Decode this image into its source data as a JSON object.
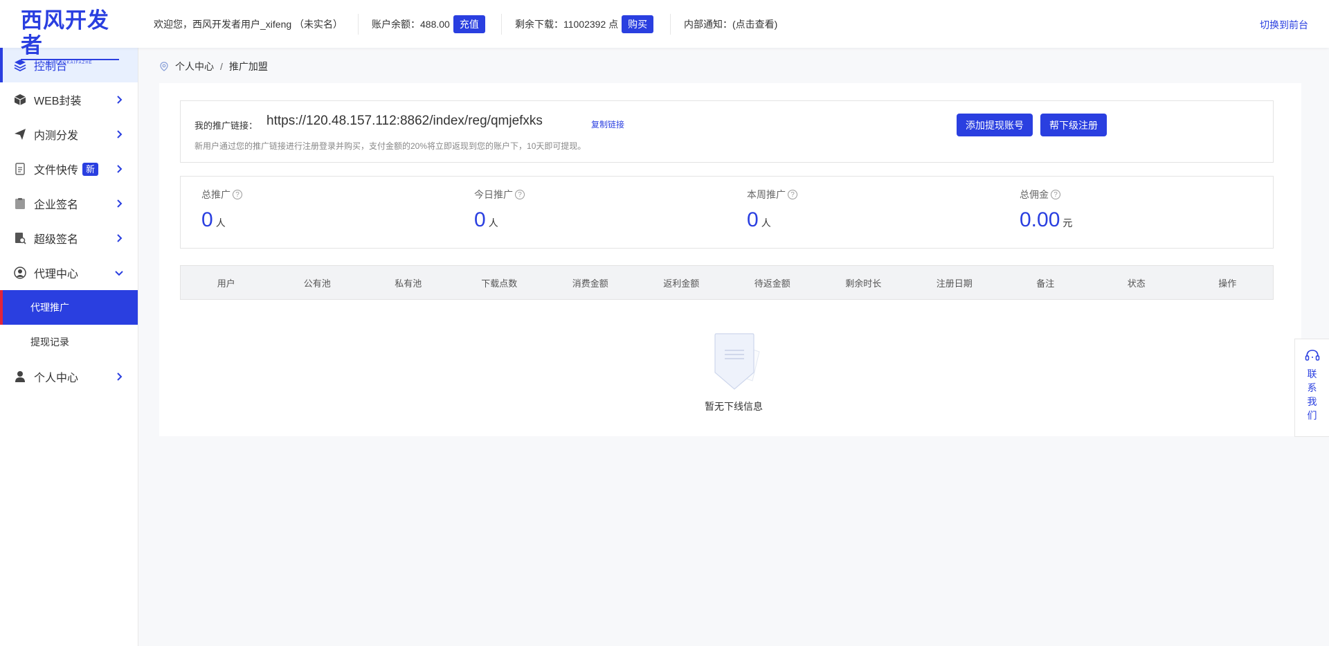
{
  "header": {
    "logo_text": "西风开发者",
    "logo_sub": "XIFENGKAIFAZHE",
    "welcome": "欢迎您，西风开发者用户_xifeng （未实名）",
    "balance_label": "账户余额：488.00",
    "recharge_btn": "充值",
    "downloads_label": "剩余下载：11002392 点",
    "buy_btn": "购买",
    "notice": "内部通知：(点击查看)",
    "switch_frontend": "切换到前台"
  },
  "sidebar": {
    "items": [
      {
        "label": "控制台",
        "icon": "layers-icon"
      },
      {
        "label": "WEB封装",
        "icon": "cube-icon"
      },
      {
        "label": "内测分发",
        "icon": "paper-plane-icon"
      },
      {
        "label": "文件快传",
        "icon": "file-transfer-icon",
        "badge": "新"
      },
      {
        "label": "企业签名",
        "icon": "clipboard-icon"
      },
      {
        "label": "超级签名",
        "icon": "document-search-icon"
      },
      {
        "label": "代理中心",
        "icon": "agent-icon"
      },
      {
        "label": "个人中心",
        "icon": "user-icon"
      }
    ],
    "agent_sub": [
      {
        "label": "代理推广"
      },
      {
        "label": "提现记录"
      }
    ]
  },
  "breadcrumb": {
    "items": [
      "个人中心",
      "推广加盟"
    ],
    "separator": "/"
  },
  "promo": {
    "link_label": "我的推广链接：",
    "link_url": "https://120.48.157.112:8862/index/reg/qmjefxks",
    "copy_label": "复制链接",
    "description": "新用户通过您的推广链接进行注册登录并购买，支付金额的20%将立即返现到您的账户下，10天即可提现。",
    "add_account_btn": "添加提现账号",
    "help_register_btn": "帮下级注册"
  },
  "stats": [
    {
      "label": "总推广",
      "value": "0",
      "unit": "人"
    },
    {
      "label": "今日推广",
      "value": "0",
      "unit": "人"
    },
    {
      "label": "本周推广",
      "value": "0",
      "unit": "人"
    },
    {
      "label": "总佣金",
      "value": "0.00",
      "unit": "元"
    }
  ],
  "table": {
    "columns": [
      "用户",
      "公有池",
      "私有池",
      "下载点数",
      "消费金额",
      "返利金额",
      "待返金额",
      "剩余时长",
      "注册日期",
      "备注",
      "状态",
      "操作"
    ],
    "rows": [],
    "empty_text": "暂无下线信息"
  },
  "contact": {
    "label": "联系我们"
  },
  "colors": {
    "accent": "#2a3fe0",
    "active_marker": "#e0243b",
    "active_bg": "#e8f0fe"
  }
}
